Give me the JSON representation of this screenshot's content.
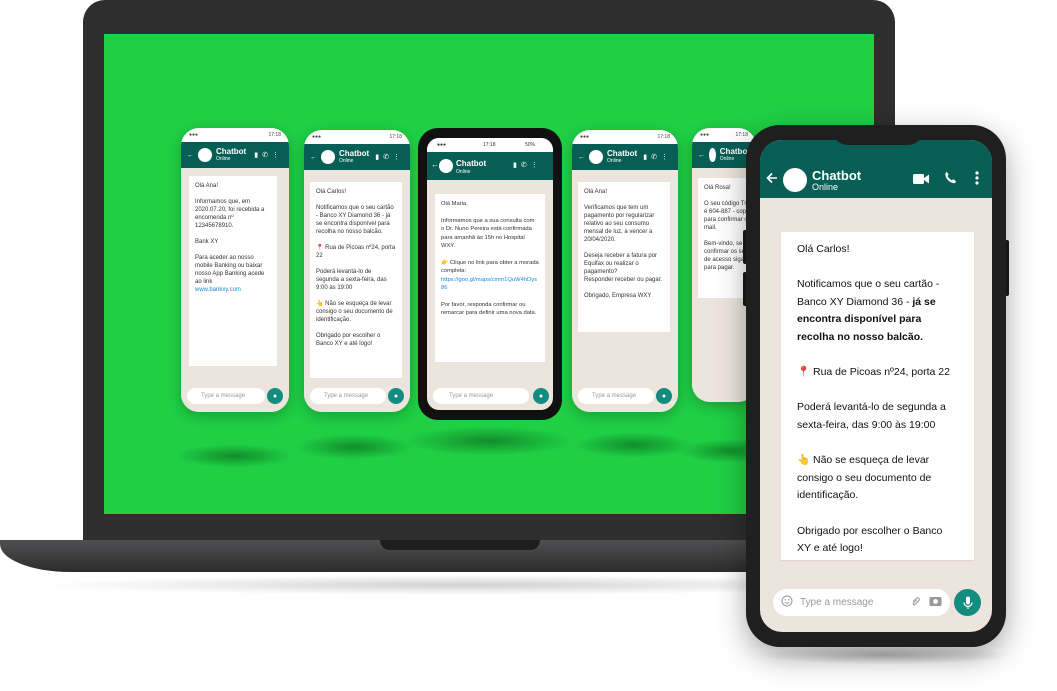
{
  "colors": {
    "screen_green": "#1fd045",
    "whatsapp_header": "#075e54",
    "mic_green": "#128c7e",
    "chat_bg": "#ece5dd"
  },
  "chat_header": {
    "name": "Chatbot",
    "status": "Online"
  },
  "input": {
    "placeholder": "Type a message"
  },
  "center_phone": {
    "time": "17:18",
    "battery": "50%",
    "greeting": "Olá Maria,",
    "p1": "Informamos que a sua consulta com o Dr. Nuno Pereira está confirmada para amanhã às 15h no Hospital WXY.",
    "p2": "👉 Clique no link para obter a morada completa:",
    "link": "https://goo.gl/maps/cmm1QuW4hDys86",
    "p3": "Por favor, responda confirmar ou remarcar para definir uma nova data."
  },
  "phone1": {
    "greeting": "Olá Ana!",
    "p1": "Informamos que, em 2020.07.20, foi recebida a encomenda nº 12345678910.",
    "p2": "Bank XY",
    "p3": "Para aceder ao nosso mobile Banking ou baixar nosso App Banking acede ao link",
    "link": "www.bankxy.com"
  },
  "phone2": {
    "time": "17:18",
    "greeting": "Olá Carlos!",
    "p1": "Notificamos que o seu cartão - Banco XY Diamond 36 - já se encontra disponível para recolha no nosso balcão.",
    "p2": "📍 Rua de Picoas nº24, porta 22",
    "p3": "Poderá levantá-lo de segunda a sexta-feira, das 9:00 às 19:00",
    "p4": "👆 Não se esqueça de levar consigo o seu documento de identificação.",
    "p5": "Obrigado por escolher o Banco XY e até logo!"
  },
  "phone4": {
    "time": "17:18",
    "greeting": "Olá Ana!",
    "p1": "Verificamos que tem um pagamento por regularizar relativo ao seu consumo mensal de luz, a vencer a 20/04/2020.",
    "p2": "Deseja receber a fatura por Equifax ou realizar o pagamento?",
    "p3": "Responder receber ou pagar.",
    "p4": "Obrigado, Empresa WXY"
  },
  "phone5": {
    "time": "17:18",
    "greeting": "Olá Rosa!",
    "p1": "O seu código Tryhandler é 604-887 - copie e cole para confirmar o seu e-mail.",
    "p2": "Bem-vindo, se desejar confirmar os seus dados de acesso siga o link para pagar."
  },
  "big_phone": {
    "greeting": "Olá Carlos!",
    "p1_normal": "Notificamos que o seu cartão - Banco XY Diamond 36 - ",
    "p1_bold": "já se encontra disponível para recolha no nosso balcão.",
    "p2": "Rua de Picoas nº24, porta 22",
    "p3": "Poderá levantá-lo de segunda a sexta-feira, das 9:00 às 19:00",
    "p4": "Não se esqueça de levar consigo o seu documento de identificação.",
    "p5": "Obrigado por escolher o Banco XY e até logo!",
    "icons": [
      "back-arrow-icon",
      "video-call-icon",
      "phone-icon",
      "menu-dots-icon",
      "emoji-icon",
      "attach-icon",
      "camera-icon",
      "mic-icon",
      "pin-icon",
      "pointing-hand-icon"
    ]
  }
}
